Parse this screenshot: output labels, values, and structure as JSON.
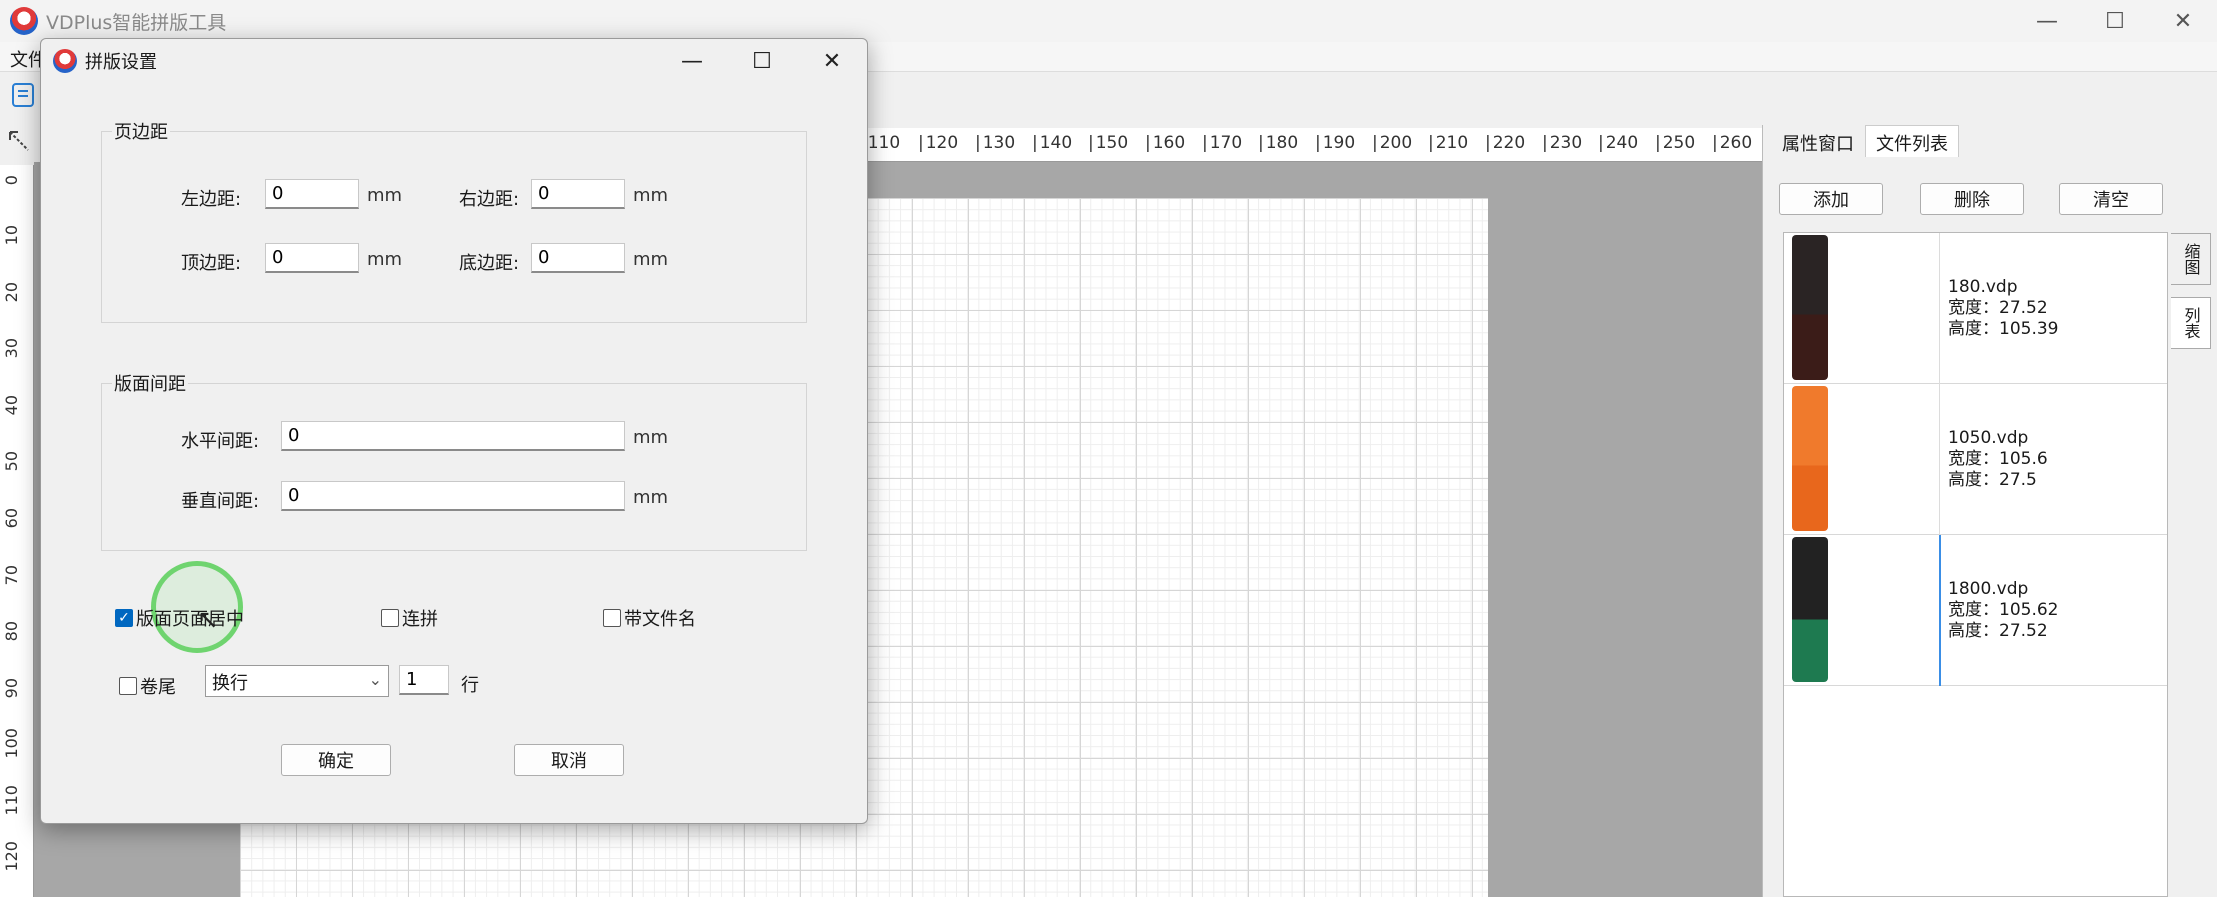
{
  "app": {
    "title": "VDPlus智能拼版工具",
    "menu_first": "文件"
  },
  "window_controls": {
    "minimize": "—",
    "maximize": "☐",
    "close": "✕"
  },
  "ruler": {
    "h_ticks": [
      "110",
      "120",
      "130",
      "140",
      "150",
      "160",
      "170",
      "180",
      "190",
      "200",
      "210",
      "220",
      "230",
      "240",
      "250",
      "260"
    ],
    "v_ticks": [
      "0",
      "10",
      "20",
      "30",
      "40",
      "50",
      "60",
      "70",
      "80",
      "90",
      "100",
      "110",
      "120"
    ]
  },
  "right_panel": {
    "tabs": [
      "属性窗口",
      "文件列表"
    ],
    "buttons": {
      "add": "添加",
      "delete": "删除",
      "clear": "清空"
    },
    "view_tabs": [
      "缩图",
      "列表"
    ],
    "files": [
      {
        "name": "180.vdp",
        "width": "宽度：27.52",
        "height": "高度：105.39",
        "thumb_top": "#2a2424",
        "thumb_bottom": "#3b1c18"
      },
      {
        "name": "1050.vdp",
        "width": "宽度：105.6",
        "height": "高度：27.5",
        "thumb_top": "#f07a2c",
        "thumb_bottom": "#e8671c"
      },
      {
        "name": "1800.vdp",
        "width": "宽度：105.62",
        "height": "高度：27.52",
        "thumb_top": "#222222",
        "thumb_bottom": "#1e7a50"
      }
    ]
  },
  "dialog": {
    "title": "拼版设置",
    "margins": {
      "group_label": "页边距",
      "left_label": "左边距:",
      "left_value": "0",
      "right_label": "右边距:",
      "right_value": "0",
      "top_label": "顶边距:",
      "top_value": "0",
      "bottom_label": "底边距:",
      "bottom_value": "0",
      "unit": "mm"
    },
    "spacing": {
      "group_label": "版面间距",
      "h_label": "水平间距:",
      "h_value": "0",
      "v_label": "垂直间距:",
      "v_value": "0",
      "unit": "mm"
    },
    "options": {
      "center_label": "版面页面居中",
      "center_checked": true,
      "continuous_label": "连拼",
      "continuous_checked": false,
      "filename_label": "带文件名",
      "filename_checked": false,
      "tail_label": "卷尾",
      "tail_checked": false,
      "wrap_select": "换行",
      "rows_value": "1",
      "rows_unit": "行"
    },
    "ok": "确定",
    "cancel": "取消"
  }
}
